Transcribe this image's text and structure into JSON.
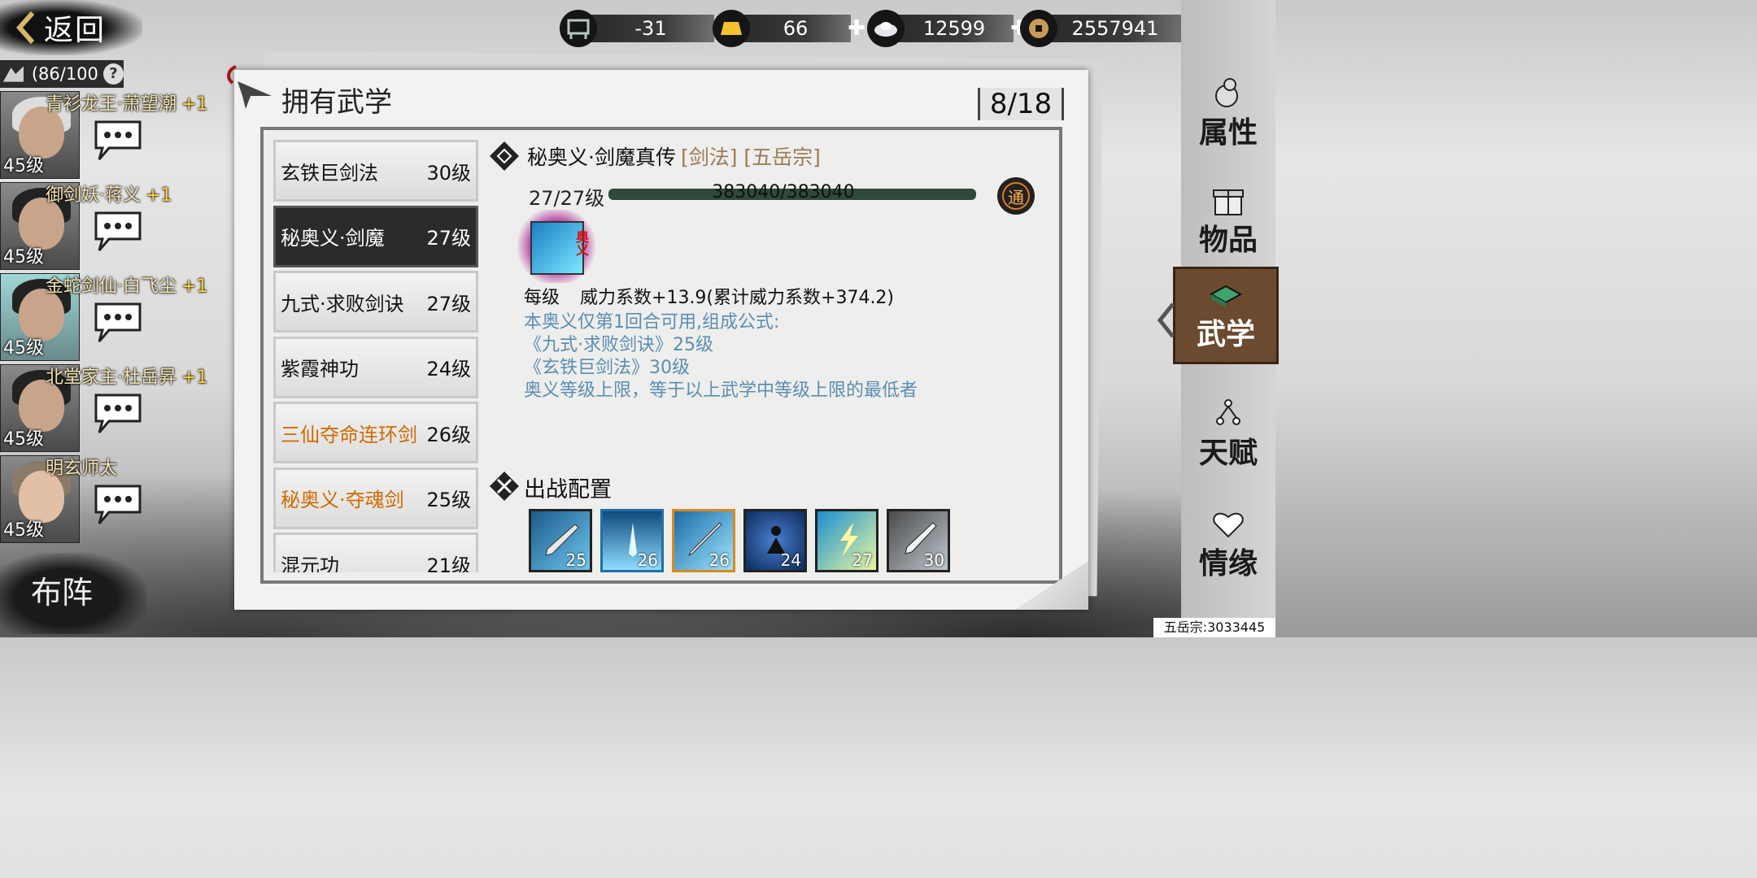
{
  "back": {
    "label": "返回"
  },
  "resources": [
    {
      "icon": "cauldron-icon",
      "value": "-31",
      "has_plus": false
    },
    {
      "icon": "gold-bar-icon",
      "value": "66",
      "has_plus": true
    },
    {
      "icon": "silver-ingot-icon",
      "value": "12599",
      "has_plus": true
    },
    {
      "icon": "copper-coin-icon",
      "value": "2557941",
      "has_plus": false
    }
  ],
  "team": {
    "capacity": "(86/100",
    "members": [
      {
        "name": "青衫龙王·萧望潮",
        "bonus": "+1",
        "level": "45级"
      },
      {
        "name": "御剑妖·蒋义",
        "bonus": "+1",
        "level": "45级"
      },
      {
        "name": "金蛇剑仙·白飞尘",
        "bonus": "+1",
        "level": "45级"
      },
      {
        "name": "北堂家主·杜岳昇",
        "bonus": "+1",
        "level": "45级"
      },
      {
        "name": "明玄师太",
        "bonus": "",
        "level": "45级"
      }
    ],
    "formation_label": "布阵"
  },
  "nav": {
    "items": [
      {
        "label": "属性"
      },
      {
        "label": "物品"
      },
      {
        "label": "武学"
      },
      {
        "label": "天赋"
      },
      {
        "label": "情缘"
      }
    ],
    "active_index": 2
  },
  "panel": {
    "title": "拥有武学",
    "count": "8/18"
  },
  "skills": [
    {
      "name": "玄铁巨剑法",
      "level": "30级",
      "style": "normal"
    },
    {
      "name": "秘奥义·剑魔",
      "level": "27级",
      "style": "selected"
    },
    {
      "name": "九式·求败剑诀",
      "level": "27级",
      "style": "normal"
    },
    {
      "name": "紫霞神功",
      "level": "24级",
      "style": "normal"
    },
    {
      "name": "三仙夺命连环剑",
      "level": "26级",
      "style": "orange"
    },
    {
      "name": "秘奥义·夺魂剑",
      "level": "25级",
      "style": "orange"
    },
    {
      "name": "混元功",
      "level": "21级",
      "style": "normal"
    }
  ],
  "detail": {
    "title": "秘奥义·剑魔真传",
    "tags": "[剑法] [五岳宗]",
    "level": "27/27级",
    "xp": "383040/383040",
    "badge": "通",
    "icon_tag": "奥义",
    "per_level_label": "每级",
    "per_level_value": "威力系数+13.9(累计威力系数+374.2)",
    "desc_lines": [
      "本奥义仅第1回合可用,组成公式:",
      "《九式·求败剑诀》25级",
      "《玄铁巨剑法》30级",
      "奥义等级上限，等于以上武学中等级上限的最低者"
    ],
    "config_title": "出战配置",
    "slots": [
      {
        "level": "25",
        "border": "#222222"
      },
      {
        "level": "26",
        "border": "#1f6fa8"
      },
      {
        "level": "26",
        "border": "#d98a1c"
      },
      {
        "level": "24",
        "border": "#222222"
      },
      {
        "level": "27",
        "border": "#222222"
      },
      {
        "level": "30",
        "border": "#222222"
      }
    ]
  },
  "footer": "五岳宗:3033445"
}
